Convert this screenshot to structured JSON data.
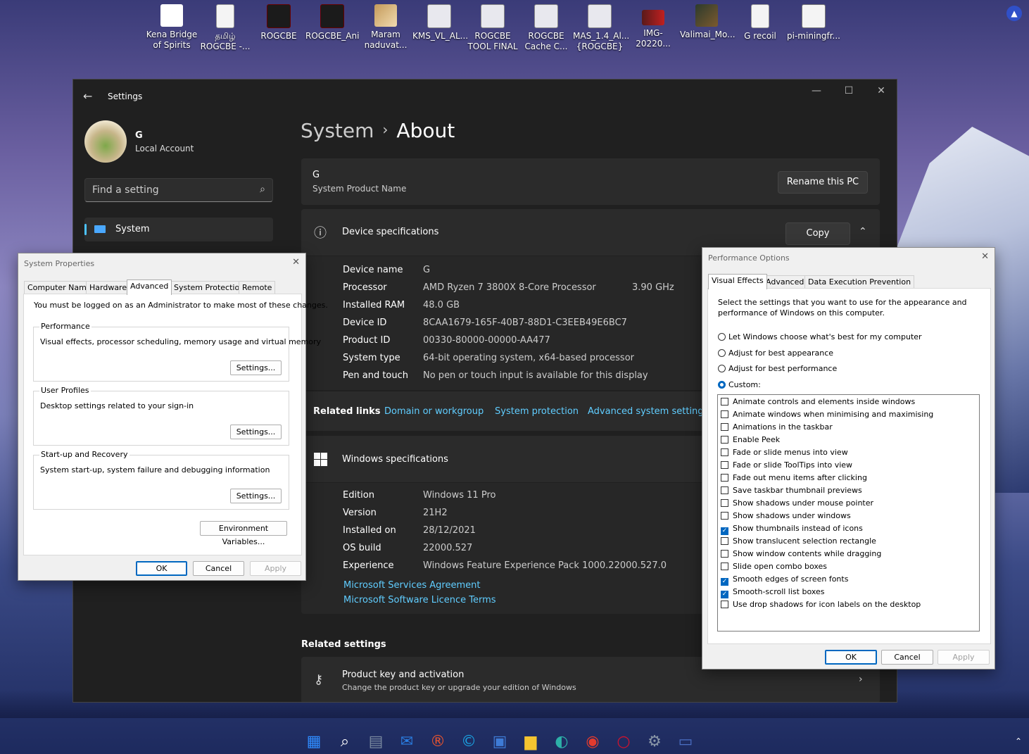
{
  "desktop": {
    "icons": [
      {
        "label": "Kena Bridge of Spirits",
        "icon": "bird-shortcut-icon"
      },
      {
        "label": "தமிழ் ROGCBE -...",
        "icon": "document-icon"
      },
      {
        "label": "ROGCBE",
        "icon": "rog-logo-icon"
      },
      {
        "label": "ROGCBE_Ani",
        "icon": "rog-logo-icon"
      },
      {
        "label": "Maram naduvat...",
        "icon": "image-file-icon"
      },
      {
        "label": "KMS_VL_AL...",
        "icon": "gear-script-icon"
      },
      {
        "label": "ROGCBE TOOL FINAL",
        "icon": "gear-script-icon"
      },
      {
        "label": "ROGCBE Cache C...",
        "icon": "gear-script-icon"
      },
      {
        "label": "MAS_1.4_Al... {ROGCBE}",
        "icon": "gear-script-icon"
      },
      {
        "label": "IMG-20220...",
        "icon": "image-file-icon"
      },
      {
        "label": "Valimai_Mo...",
        "icon": "movie-file-icon"
      },
      {
        "label": "G recoil",
        "icon": "document-icon"
      },
      {
        "label": "pi-miningfr...",
        "icon": "pi-network-icon"
      }
    ]
  },
  "settings": {
    "window_title": "Settings",
    "user": {
      "name": "G",
      "account_type": "Local Account"
    },
    "search": {
      "placeholder": "Find a setting"
    },
    "nav": {
      "active": "System"
    },
    "breadcrumb": {
      "parent": "System",
      "current": "About"
    },
    "pc_card": {
      "name": "G",
      "subtitle": "System Product Name",
      "rename_button": "Rename this PC"
    },
    "device_specs": {
      "title": "Device specifications",
      "copy_button": "Copy",
      "rows": [
        {
          "key": "Device name",
          "value": "G"
        },
        {
          "key": "Processor",
          "value": "AMD Ryzen 7 3800X 8-Core Processor",
          "extra": "3.90 GHz"
        },
        {
          "key": "Installed RAM",
          "value": "48.0 GB"
        },
        {
          "key": "Device ID",
          "value": "8CAA1679-165F-40B7-88D1-C3EEB49E6BC7"
        },
        {
          "key": "Product ID",
          "value": "00330-80000-00000-AA477"
        },
        {
          "key": "System type",
          "value": "64-bit operating system, x64-based processor"
        },
        {
          "key": "Pen and touch",
          "value": "No pen or touch input is available for this display"
        }
      ]
    },
    "related_links": {
      "label": "Related links",
      "links": [
        "Domain or workgroup",
        "System protection",
        "Advanced system settings"
      ]
    },
    "windows_specs": {
      "title": "Windows specifications",
      "rows": [
        {
          "key": "Edition",
          "value": "Windows 11 Pro"
        },
        {
          "key": "Version",
          "value": "21H2"
        },
        {
          "key": "Installed on",
          "value": "28/12/2021"
        },
        {
          "key": "OS build",
          "value": "22000.527"
        },
        {
          "key": "Experience",
          "value": "Windows Feature Experience Pack 1000.22000.527.0"
        }
      ],
      "links": [
        "Microsoft Services Agreement",
        "Microsoft Software Licence Terms"
      ]
    },
    "related_settings": {
      "title": "Related settings",
      "item_title": "Product key and activation",
      "item_subtitle": "Change the product key or upgrade your edition of Windows"
    }
  },
  "system_properties": {
    "title": "System Properties",
    "tabs": [
      "Computer Name",
      "Hardware",
      "Advanced",
      "System Protection",
      "Remote"
    ],
    "active_tab": "Advanced",
    "admin_note": "You must be logged on as an Administrator to make most of these changes.",
    "groups": [
      {
        "label": "Performance",
        "text": "Visual effects, processor scheduling, memory usage and virtual memory",
        "button": "Settings..."
      },
      {
        "label": "User Profiles",
        "text": "Desktop settings related to your sign-in",
        "button": "Settings..."
      },
      {
        "label": "Start-up and Recovery",
        "text": "System start-up, system failure and debugging information",
        "button": "Settings..."
      }
    ],
    "env_button": "Environment Variables...",
    "ok": "OK",
    "cancel": "Cancel",
    "apply": "Apply"
  },
  "performance_options": {
    "title": "Performance Options",
    "tabs": [
      "Visual Effects",
      "Advanced",
      "Data Execution Prevention"
    ],
    "active_tab": "Visual Effects",
    "intro": "Select the settings that you want to use for the appearance and performance of Windows on this computer.",
    "radios": [
      {
        "label": "Let Windows choose what's best for my computer",
        "selected": false
      },
      {
        "label": "Adjust for best appearance",
        "selected": false
      },
      {
        "label": "Adjust for best performance",
        "selected": false
      },
      {
        "label": "Custom:",
        "selected": true
      }
    ],
    "options": [
      {
        "label": "Animate controls and elements inside windows",
        "checked": false
      },
      {
        "label": "Animate windows when minimising and maximising",
        "checked": false
      },
      {
        "label": "Animations in the taskbar",
        "checked": false
      },
      {
        "label": "Enable Peek",
        "checked": false
      },
      {
        "label": "Fade or slide menus into view",
        "checked": false
      },
      {
        "label": "Fade or slide ToolTips into view",
        "checked": false
      },
      {
        "label": "Fade out menu items after clicking",
        "checked": false
      },
      {
        "label": "Save taskbar thumbnail previews",
        "checked": false
      },
      {
        "label": "Show shadows under mouse pointer",
        "checked": false
      },
      {
        "label": "Show shadows under windows",
        "checked": false
      },
      {
        "label": "Show thumbnails instead of icons",
        "checked": true
      },
      {
        "label": "Show translucent selection rectangle",
        "checked": false
      },
      {
        "label": "Show window contents while dragging",
        "checked": false
      },
      {
        "label": "Slide open combo boxes",
        "checked": false
      },
      {
        "label": "Smooth edges of screen fonts",
        "checked": true
      },
      {
        "label": "Smooth-scroll list boxes",
        "checked": true
      },
      {
        "label": "Use drop shadows for icon labels on the desktop",
        "checked": false
      }
    ],
    "ok": "OK",
    "cancel": "Cancel",
    "apply": "Apply"
  },
  "taskbar": {
    "icons": [
      "start-icon",
      "search-icon",
      "calculator-icon",
      "mail-icon",
      "app-r-icon",
      "ccleaner-icon",
      "store-icon",
      "file-explorer-icon",
      "edge-icon",
      "chrome-icon",
      "opera-icon",
      "settings-icon",
      "remote-desktop-icon"
    ],
    "colors": {
      "accent": "#0067c0",
      "link": "#60cdff"
    }
  }
}
